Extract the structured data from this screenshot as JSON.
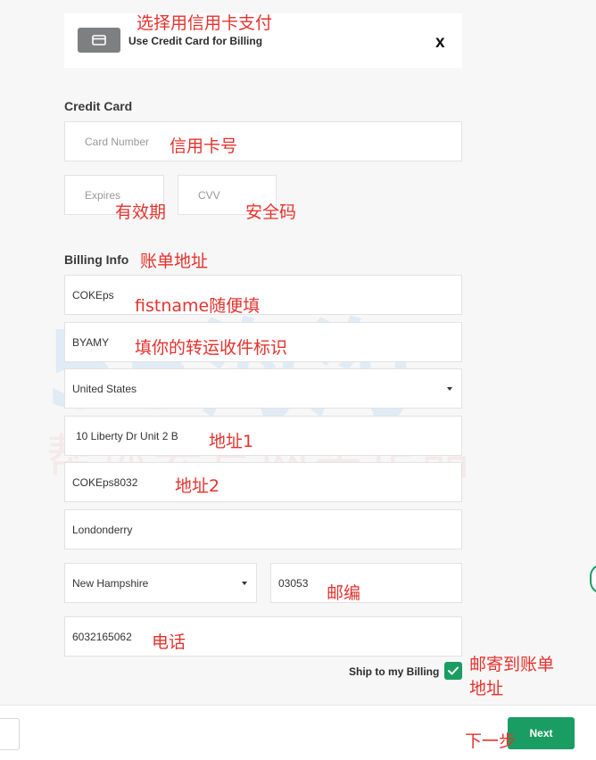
{
  "header": {
    "title": "Use Credit Card for Billing",
    "close": "x"
  },
  "credit_card": {
    "section_title": "Credit Card",
    "card_number_placeholder": "Card Number",
    "expires_placeholder": "Expires",
    "cvv_placeholder": "CVV"
  },
  "billing": {
    "section_title": "Billing Info",
    "first_name": "COKEps",
    "last_name": "BYAMY",
    "country": "United States",
    "address1": "10 Liberty Dr Unit 2 B",
    "address2": "COKEps8032",
    "city": "Londonderry",
    "state": "New Hampshire",
    "zip": "03053",
    "phone": "6032165062",
    "ship_to_billing_label": "Ship to my Billing",
    "ship_to_billing_checked": true
  },
  "footer": {
    "next_label": "Next"
  },
  "watermark": {
    "big": "55海淘",
    "small": "帮你去官网买正品"
  },
  "annotations": {
    "use_card": "选择用信用卡支付",
    "card_number": "信用卡号",
    "expires": "有效期",
    "cvv": "安全码",
    "billing": "账单地址",
    "first_name": "fistname随便填",
    "last_name": "填你的转运收件标识",
    "address1": "地址1",
    "address2": "地址2",
    "zip": "邮编",
    "phone": "电话",
    "ship_line1": "邮寄到账单",
    "ship_line2": "地址",
    "next": "下一步"
  },
  "colors": {
    "accent_green": "#1a9d62",
    "annotation_red": "#e5322d"
  }
}
